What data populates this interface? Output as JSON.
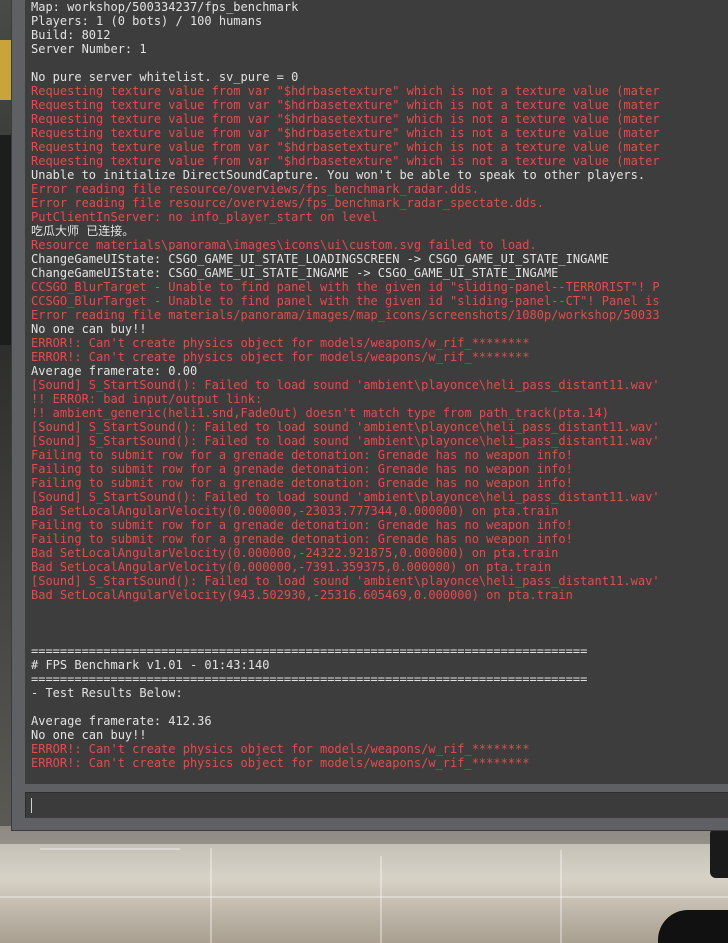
{
  "console": {
    "lines": [
      {
        "text": "Map: workshop/500334237/fps_benchmark",
        "type": "normal"
      },
      {
        "text": "Players: 1 (0 bots) / 100 humans",
        "type": "normal"
      },
      {
        "text": "Build: 8012",
        "type": "normal"
      },
      {
        "text": "Server Number: 1",
        "type": "normal"
      },
      {
        "text": "",
        "type": "blank"
      },
      {
        "text": "No pure server whitelist. sv_pure = 0",
        "type": "normal"
      },
      {
        "text": "Requesting texture value from var \"$hdrbasetexture\" which is not a texture value (mater",
        "type": "err"
      },
      {
        "text": "Requesting texture value from var \"$hdrbasetexture\" which is not a texture value (mater",
        "type": "err"
      },
      {
        "text": "Requesting texture value from var \"$hdrbasetexture\" which is not a texture value (mater",
        "type": "err"
      },
      {
        "text": "Requesting texture value from var \"$hdrbasetexture\" which is not a texture value (mater",
        "type": "err"
      },
      {
        "text": "Requesting texture value from var \"$hdrbasetexture\" which is not a texture value (mater",
        "type": "err"
      },
      {
        "text": "Requesting texture value from var \"$hdrbasetexture\" which is not a texture value (mater",
        "type": "err"
      },
      {
        "text": "Unable to initialize DirectSoundCapture. You won't be able to speak to other players.",
        "type": "normal"
      },
      {
        "text": "Error reading file resource/overviews/fps_benchmark_radar.dds.",
        "type": "err"
      },
      {
        "text": "Error reading file resource/overviews/fps_benchmark_radar_spectate.dds.",
        "type": "err"
      },
      {
        "text": "PutClientInServer: no info_player_start on level",
        "type": "err"
      },
      {
        "text": "吃瓜大师 已连接。",
        "type": "normal"
      },
      {
        "text": "Resource materials\\panorama\\images\\icons\\ui\\custom.svg failed to load.",
        "type": "err"
      },
      {
        "text": "ChangeGameUIState: CSGO_GAME_UI_STATE_LOADINGSCREEN -> CSGO_GAME_UI_STATE_INGAME",
        "type": "normal"
      },
      {
        "text": "ChangeGameUIState: CSGO_GAME_UI_STATE_INGAME -> CSGO_GAME_UI_STATE_INGAME",
        "type": "normal"
      },
      {
        "text": "CCSGO_BlurTarget - Unable to find panel with the given id \"sliding-panel--TERRORIST\"! P",
        "type": "err"
      },
      {
        "text": "CCSGO_BlurTarget - Unable to find panel with the given id \"sliding-panel--CT\"! Panel is",
        "type": "err"
      },
      {
        "text": "Error reading file materials/panorama/images/map_icons/screenshots/1080p/workshop/50033",
        "type": "err"
      },
      {
        "text": "No one can buy!!",
        "type": "normal"
      },
      {
        "text": "ERROR!: Can't create physics object for models/weapons/w_rif_********",
        "type": "err"
      },
      {
        "text": "ERROR!: Can't create physics object for models/weapons/w_rif_********",
        "type": "err"
      },
      {
        "text": "Average framerate: 0.00",
        "type": "normal"
      },
      {
        "text": "[Sound] S_StartSound(): Failed to load sound 'ambient\\playonce\\heli_pass_distant11.wav'",
        "type": "err"
      },
      {
        "text": "!! ERROR: bad input/output link:",
        "type": "err"
      },
      {
        "text": "!! ambient_generic(heli1.snd,FadeOut) doesn't match type from path_track(pta.14)",
        "type": "err"
      },
      {
        "text": "[Sound] S_StartSound(): Failed to load sound 'ambient\\playonce\\heli_pass_distant11.wav'",
        "type": "err"
      },
      {
        "text": "[Sound] S_StartSound(): Failed to load sound 'ambient\\playonce\\heli_pass_distant11.wav'",
        "type": "err"
      },
      {
        "text": "Failing to submit row for a grenade detonation: Grenade has no weapon info!",
        "type": "err"
      },
      {
        "text": "Failing to submit row for a grenade detonation: Grenade has no weapon info!",
        "type": "err"
      },
      {
        "text": "Failing to submit row for a grenade detonation: Grenade has no weapon info!",
        "type": "err"
      },
      {
        "text": "[Sound] S_StartSound(): Failed to load sound 'ambient\\playonce\\heli_pass_distant11.wav'",
        "type": "err"
      },
      {
        "text": "Bad SetLocalAngularVelocity(0.000000,-23033.777344,0.000000) on pta.train",
        "type": "err"
      },
      {
        "text": "Failing to submit row for a grenade detonation: Grenade has no weapon info!",
        "type": "err"
      },
      {
        "text": "Failing to submit row for a grenade detonation: Grenade has no weapon info!",
        "type": "err"
      },
      {
        "text": "Bad SetLocalAngularVelocity(0.000000,-24322.921875,0.000000) on pta.train",
        "type": "err"
      },
      {
        "text": "Bad SetLocalAngularVelocity(0.000000,-7391.359375,0.000000) on pta.train",
        "type": "err"
      },
      {
        "text": "[Sound] S_StartSound(): Failed to load sound 'ambient\\playonce\\heli_pass_distant11.wav'",
        "type": "err"
      },
      {
        "text": "Bad SetLocalAngularVelocity(943.502930,-25316.605469,0.000000) on pta.train",
        "type": "err"
      },
      {
        "text": "",
        "type": "blank"
      },
      {
        "text": "",
        "type": "blank"
      },
      {
        "text": "",
        "type": "blank"
      },
      {
        "text": "=============================================================================",
        "type": "normal"
      },
      {
        "text": "# FPS Benchmark v1.01 - 01:43:140",
        "type": "normal"
      },
      {
        "text": "=============================================================================",
        "type": "normal"
      },
      {
        "text": "- Test Results Below:",
        "type": "normal"
      },
      {
        "text": "",
        "type": "blank"
      },
      {
        "text": "Average framerate: 412.36",
        "type": "normal"
      },
      {
        "text": "No one can buy!!",
        "type": "normal"
      },
      {
        "text": "ERROR!: Can't create physics object for models/weapons/w_rif_********",
        "type": "err"
      },
      {
        "text": "ERROR!: Can't create physics object for models/weapons/w_rif_********",
        "type": "err"
      }
    ],
    "input": {
      "value": ""
    }
  }
}
